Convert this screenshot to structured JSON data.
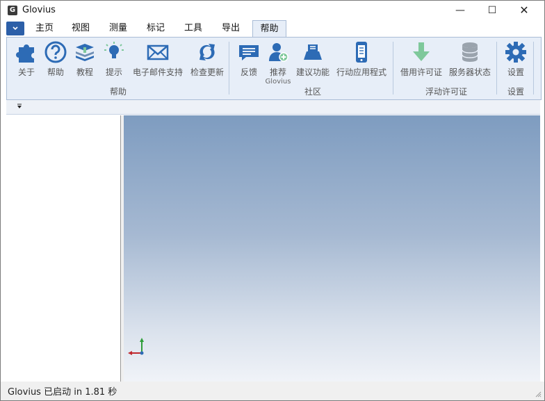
{
  "window": {
    "title": "Glovius",
    "icon_letter": "G"
  },
  "window_controls": {
    "minimize": "—",
    "maximize": "☐",
    "close": "✕"
  },
  "tabs": [
    {
      "label": "主页"
    },
    {
      "label": "视图"
    },
    {
      "label": "测量"
    },
    {
      "label": "标记"
    },
    {
      "label": "工具"
    },
    {
      "label": "导出"
    },
    {
      "label": "帮助",
      "active": true
    }
  ],
  "ribbon": {
    "groups": [
      {
        "label": "帮助",
        "buttons": [
          {
            "label": "关于",
            "icon": "puzzle-icon"
          },
          {
            "label": "帮助",
            "icon": "question-icon"
          },
          {
            "label": "教程",
            "icon": "books-icon"
          },
          {
            "label": "提示",
            "icon": "lightbulb-icon"
          },
          {
            "label": "电子邮件支持",
            "icon": "envelope-icon"
          },
          {
            "label": "检查更新",
            "icon": "refresh-icon"
          }
        ]
      },
      {
        "label": "社区",
        "buttons": [
          {
            "label": "反馈",
            "icon": "chat-bubble-icon"
          },
          {
            "label": "推荐",
            "sublabel": "Glovius",
            "icon": "add-user-icon"
          },
          {
            "label": "建议功能",
            "icon": "suggest-icon"
          },
          {
            "label": "行动应用程式",
            "icon": "mobile-icon"
          }
        ]
      },
      {
        "label": "浮动许可证",
        "buttons": [
          {
            "label": "借用许可证",
            "icon": "download-arrow-icon"
          },
          {
            "label": "服务器状态",
            "icon": "database-icon"
          }
        ]
      },
      {
        "label": "设置",
        "buttons": [
          {
            "label": "设置",
            "icon": "gear-icon"
          }
        ]
      }
    ]
  },
  "quick_access": {
    "icon": "dropdown-arrow-icon"
  },
  "status_bar": {
    "text": "Glovius 已启动 in 1.81 秒"
  },
  "colors": {
    "ribbon_bg": "#e7eef8",
    "icon_blue": "#2d6bb5",
    "icon_green": "#7ec89b",
    "icon_gray": "#9aa3ad",
    "viewport_top": "#7e9cc0",
    "viewport_bottom": "#f0f3f8"
  }
}
